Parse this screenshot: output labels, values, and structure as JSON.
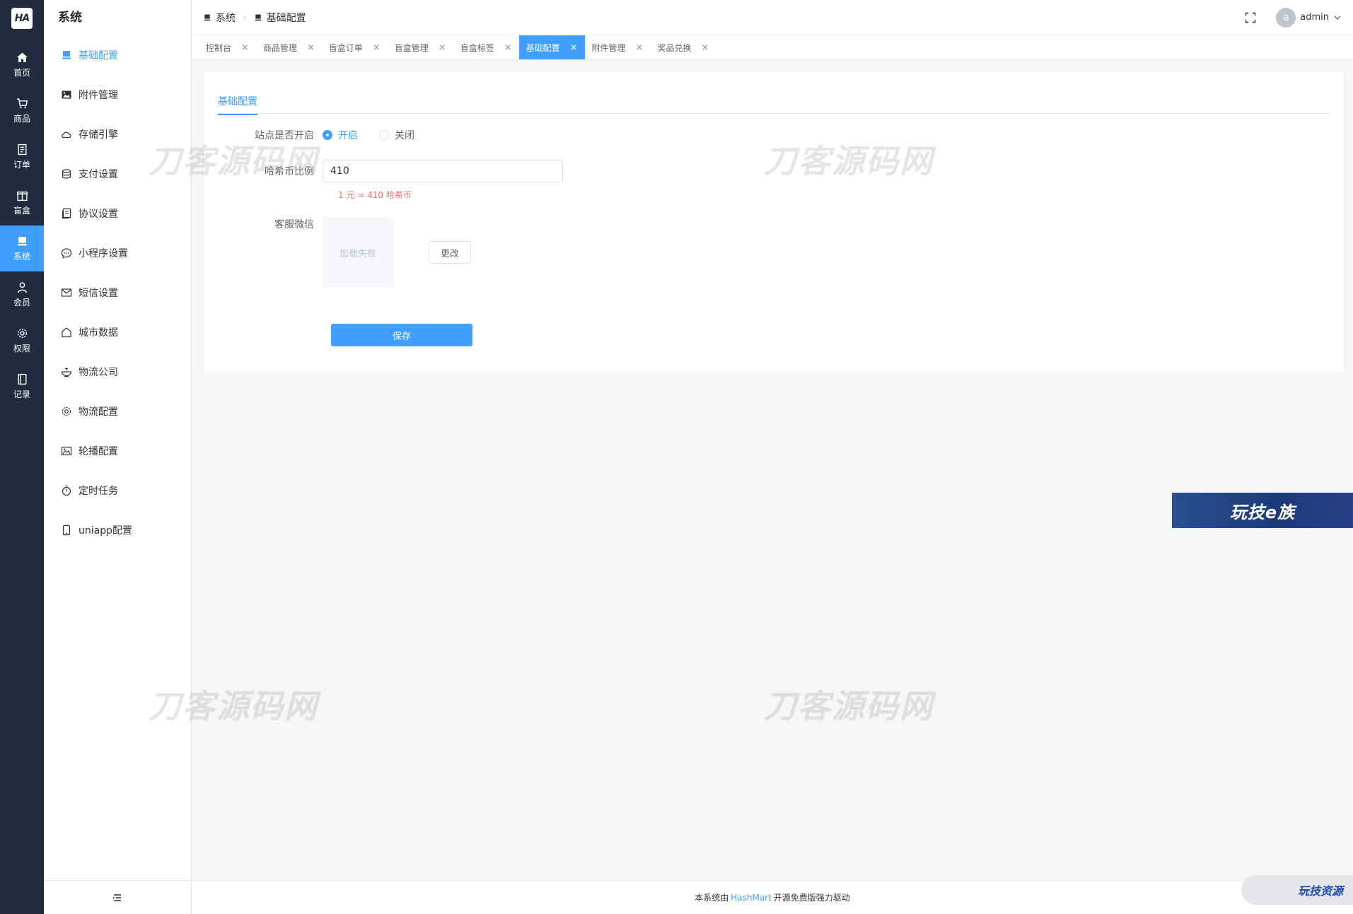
{
  "logo": {
    "text": "HA"
  },
  "rail": [
    {
      "label": "首页",
      "icon": "home-icon"
    },
    {
      "label": "商品",
      "icon": "cart-icon"
    },
    {
      "label": "订单",
      "icon": "order-icon"
    },
    {
      "label": "盲盒",
      "icon": "box-icon"
    },
    {
      "label": "系统",
      "icon": "monitor-icon",
      "active": true
    },
    {
      "label": "会员",
      "icon": "user-icon"
    },
    {
      "label": "权限",
      "icon": "gear-icon"
    },
    {
      "label": "记录",
      "icon": "record-icon"
    }
  ],
  "sidebar": {
    "title": "系统",
    "items": [
      {
        "label": "基础配置",
        "icon": "monitor-icon",
        "active": true
      },
      {
        "label": "附件管理",
        "icon": "image-icon"
      },
      {
        "label": "存储引擎",
        "icon": "cloud-icon"
      },
      {
        "label": "支付设置",
        "icon": "coins-icon"
      },
      {
        "label": "协议设置",
        "icon": "document-icon"
      },
      {
        "label": "小程序设置",
        "icon": "chat-icon"
      },
      {
        "label": "短信设置",
        "icon": "mail-icon"
      },
      {
        "label": "城市数据",
        "icon": "house-icon"
      },
      {
        "label": "物流公司",
        "icon": "bowl-icon"
      },
      {
        "label": "物流配置",
        "icon": "gear-icon"
      },
      {
        "label": "轮播配置",
        "icon": "picture-icon"
      },
      {
        "label": "定时任务",
        "icon": "timer-icon"
      },
      {
        "label": "uniapp配置",
        "icon": "phone-icon"
      }
    ]
  },
  "header": {
    "breadcrumb": [
      "系统",
      "基础配置"
    ],
    "user": {
      "avatar_letter": "a",
      "name": "admin"
    }
  },
  "tabs": [
    {
      "label": "控制台"
    },
    {
      "label": "商品管理"
    },
    {
      "label": "盲盒订单"
    },
    {
      "label": "盲盒管理"
    },
    {
      "label": "盲盒标签"
    },
    {
      "label": "基础配置",
      "active": true
    },
    {
      "label": "附件管理"
    },
    {
      "label": "奖品兑换"
    }
  ],
  "card": {
    "tab": "基础配置",
    "site_open": {
      "label": "站点是否开启",
      "options": [
        "开启",
        "关闭"
      ],
      "selected": "开启"
    },
    "rate": {
      "label": "哈希币比例",
      "value": "410",
      "hint": "1 元 = 410 哈希币"
    },
    "wechat": {
      "label": "客服微信",
      "image_alt": "加载失败",
      "change_label": "更改"
    },
    "save_label": "保存"
  },
  "watermarks": {
    "text": "刀客源码网",
    "badge_blue": "玩技e族",
    "badge_gray": "玩技资源"
  },
  "footer": {
    "prefix": "本系统由",
    "link": "HashMart",
    "suffix": "开源免费版强力驱动"
  },
  "colors": {
    "primary": "#409eff",
    "rail_bg": "#232c3f",
    "danger": "#f56c6c"
  }
}
